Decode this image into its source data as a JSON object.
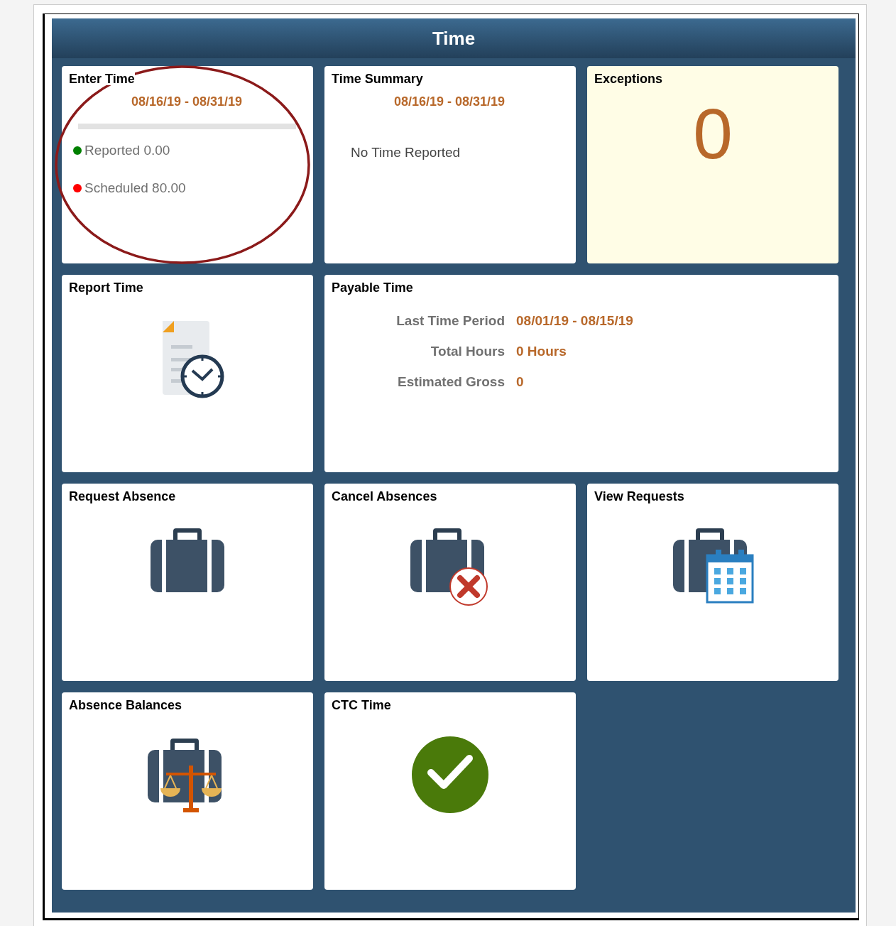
{
  "panel": {
    "title": "Time"
  },
  "tiles": [
    {
      "kind": "summary",
      "title": "Enter Time",
      "period": "08/16/19 - 08/31/19",
      "legend": [
        {
          "label": "Reported 0.00",
          "color": "#008000"
        },
        {
          "label": "Scheduled 80.00",
          "color": "#ff0000"
        }
      ]
    },
    {
      "kind": "period",
      "title": "Time Summary",
      "period": "08/16/19 - 08/31/19",
      "message": "No Time Reported"
    },
    {
      "kind": "count",
      "title": "Exceptions",
      "value": "0"
    },
    {
      "kind": "icon",
      "title": "Report Time"
    },
    {
      "kind": "info",
      "title": "Payable Time",
      "rows": [
        {
          "label": "Last Time Period",
          "value": "08/01/19 - 08/15/19"
        },
        {
          "label": "Total Hours",
          "value": "0 Hours"
        },
        {
          "label": "Estimated Gross",
          "value": "0"
        }
      ]
    },
    {
      "kind": "icon",
      "title": "Request Absence"
    },
    {
      "kind": "icon",
      "title": "Cancel Absences"
    },
    {
      "kind": "icon",
      "title": "View Requests"
    },
    {
      "kind": "icon",
      "title": "Absence Balances"
    },
    {
      "kind": "icon",
      "title": "CTC Time"
    }
  ]
}
